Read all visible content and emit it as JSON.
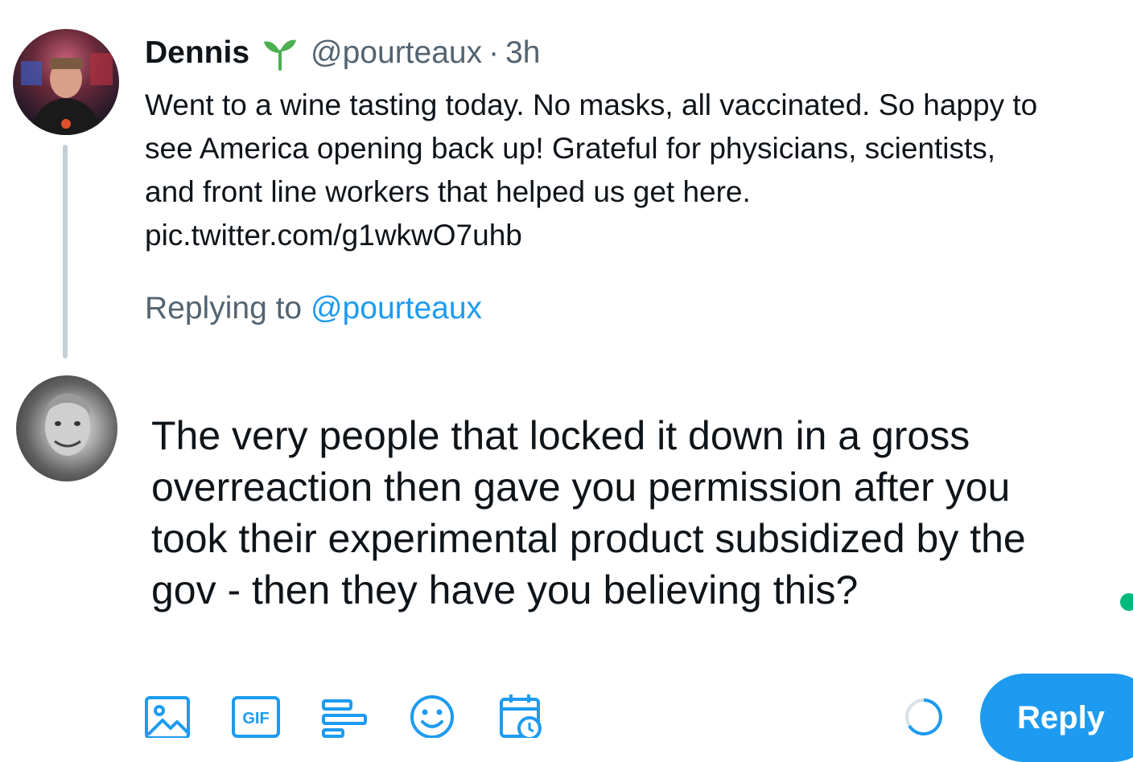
{
  "original_tweet": {
    "author_name": "Dennis",
    "badge_icon": "sprout-icon",
    "handle": "@pourteaux",
    "separator": "·",
    "time_ago": "3h",
    "text_lines": [
      "Went to a wine tasting today. No masks, all vaccinated. So happy to",
      "see America opening back up! Grateful for physicians, scientists,",
      "and front line workers that helped us get here.",
      "pic.twitter.com/g1wkwO7uhb"
    ]
  },
  "reply_context": {
    "prefix": "Replying to",
    "mention": "@pourteaux"
  },
  "compose": {
    "text_lines": [
      "The very people that locked it down in a gross",
      "overreaction then gave you permission after you",
      "took their experimental product subsidized by the",
      "gov - then they have you believing this?"
    ]
  },
  "toolbar": {
    "icons": [
      "image-icon",
      "gif-icon",
      "poll-icon",
      "emoji-icon",
      "schedule-icon"
    ],
    "gif_label": "GIF",
    "reply_label": "Reply"
  },
  "colors": {
    "accent": "#1d9bf0",
    "muted_text": "#536471",
    "primary_text": "#0f1419",
    "thread_line": "#c4cfd6",
    "sprout": "#4caf50",
    "status_dot": "#00ba7c"
  }
}
